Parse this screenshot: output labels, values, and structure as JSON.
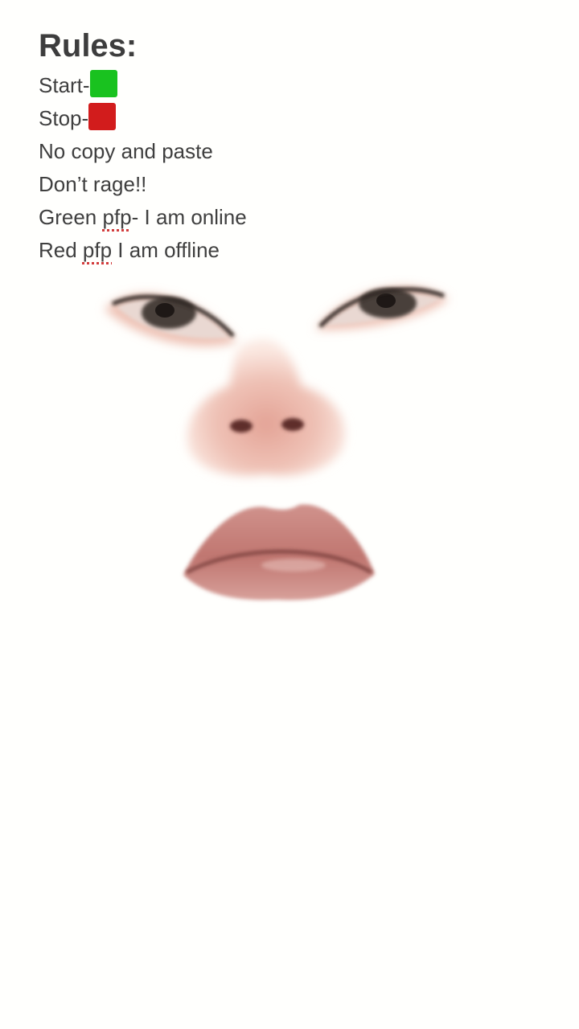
{
  "rules": {
    "title": "Rules:",
    "start_label": "Start-",
    "start_color": "#19c21f",
    "stop_label": "Stop-",
    "stop_color": "#d21c1c",
    "line3": "No copy and paste",
    "line4": "Don’t rage!!",
    "line5_prefix": "Green ",
    "line5_word": "pfp",
    "line5_suffix": "- I am online",
    "line6_prefix": "Red ",
    "line6_word": "pfp",
    "line6_suffix": " I am offline"
  },
  "face": {
    "skin_color": "#e8b0a4",
    "lip_color": "#c97f7c",
    "eye_color": "#3b3330"
  }
}
